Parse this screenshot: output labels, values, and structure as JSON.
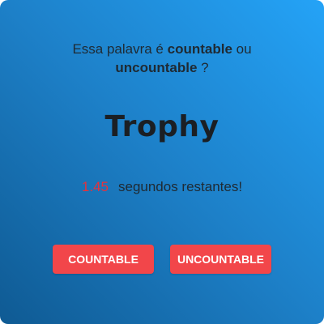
{
  "question": {
    "prefix": "Essa palavra é ",
    "option_a": "countable",
    "middle": " ou",
    "option_b": "uncountable",
    "suffix": " ?"
  },
  "word": "Trophy",
  "timer": {
    "seconds": "1.45",
    "label": "segundos restantes!"
  },
  "buttons": {
    "countable_label": "COUNTABLE",
    "uncountable_label": "UNCOUNTABLE"
  },
  "colors": {
    "gradient_light": "#24a3f7",
    "gradient_dark": "#0f5a93",
    "button": "#f2464a",
    "timer_number": "#e8313a"
  }
}
